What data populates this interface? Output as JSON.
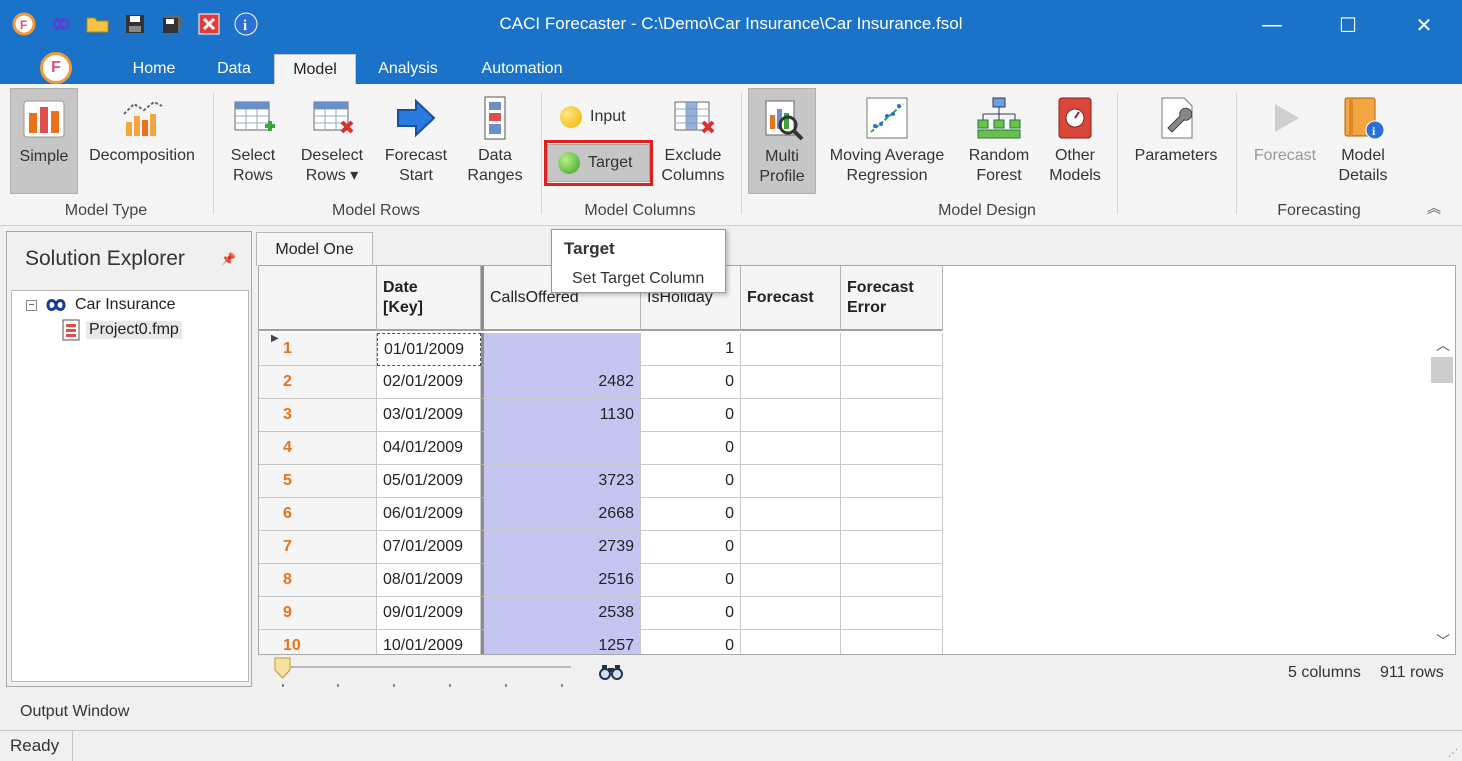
{
  "window": {
    "title": "CACI Forecaster - C:\\Demo\\Car Insurance\\Car Insurance.fsol",
    "minimize": "—",
    "maximize": "☐",
    "close": "✕"
  },
  "quick_access": [
    {
      "icon": "forecaster-logo-icon"
    },
    {
      "icon": "infinity-link-icon"
    },
    {
      "icon": "open-folder-icon"
    },
    {
      "icon": "save-icon"
    },
    {
      "icon": "save-all-icon"
    },
    {
      "icon": "close-red-icon"
    },
    {
      "icon": "info-icon"
    }
  ],
  "app_logo": "F",
  "tabs": [
    "Home",
    "Data",
    "Model",
    "Analysis",
    "Automation"
  ],
  "active_tab": "Model",
  "ribbon": {
    "model_type": {
      "label": "Model Type",
      "simple": "Simple",
      "decomposition": "Decomposition"
    },
    "model_rows": {
      "label": "Model Rows",
      "select_rows": [
        "Select",
        "Rows"
      ],
      "deselect_rows": [
        "Deselect",
        "Rows ▾"
      ],
      "forecast_start": [
        "Forecast",
        "Start"
      ],
      "data_ranges": [
        "Data",
        "Ranges"
      ]
    },
    "model_columns": {
      "label": "Model Columns",
      "input": "Input",
      "target": "Target",
      "exclude_columns": [
        "Exclude",
        "Columns"
      ]
    },
    "model_design": {
      "label": "Model Design",
      "multi_profile": [
        "Multi",
        "Profile"
      ],
      "moving_average": [
        "Moving Average",
        "Regression"
      ],
      "random_forest": [
        "Random",
        "Forest"
      ],
      "other_models": [
        "Other",
        "Models"
      ],
      "parameters": "Parameters"
    },
    "forecasting": {
      "label": "Forecasting",
      "forecast": "Forecast",
      "model_details": [
        "Model",
        "Details"
      ]
    }
  },
  "colors": {
    "title_bar": "#1a73c8",
    "target_highlight": "#e02020",
    "target_column_bg": "#c5c5f2",
    "row_number": "#e8731a"
  },
  "solution_explorer": {
    "title": "Solution Explorer",
    "tree": {
      "root": "Car Insurance",
      "child": "Project0.fmp"
    }
  },
  "document_tab": "Model One",
  "grid": {
    "columns": [
      {
        "label": [
          "Date",
          "[Key]"
        ],
        "bold": true
      },
      {
        "label": [
          "CallsOffered"
        ],
        "bold": false
      },
      {
        "label": [
          "IsHoliday"
        ],
        "bold": false
      },
      {
        "label": [
          "Forecast"
        ],
        "bold": true
      },
      {
        "label": [
          "Forecast",
          "Error"
        ],
        "bold": true
      }
    ],
    "rows": [
      {
        "n": "1",
        "date": "01/01/2009",
        "calls": "",
        "holiday": "1"
      },
      {
        "n": "2",
        "date": "02/01/2009",
        "calls": "2482",
        "holiday": "0"
      },
      {
        "n": "3",
        "date": "03/01/2009",
        "calls": "1130",
        "holiday": "0"
      },
      {
        "n": "4",
        "date": "04/01/2009",
        "calls": "",
        "holiday": "0"
      },
      {
        "n": "5",
        "date": "05/01/2009",
        "calls": "3723",
        "holiday": "0"
      },
      {
        "n": "6",
        "date": "06/01/2009",
        "calls": "2668",
        "holiday": "0"
      },
      {
        "n": "7",
        "date": "07/01/2009",
        "calls": "2739",
        "holiday": "0"
      },
      {
        "n": "8",
        "date": "08/01/2009",
        "calls": "2516",
        "holiday": "0"
      },
      {
        "n": "9",
        "date": "09/01/2009",
        "calls": "2538",
        "holiday": "0"
      },
      {
        "n": "10",
        "date": "10/01/2009",
        "calls": "1257",
        "holiday": "0"
      }
    ]
  },
  "grid_footer": {
    "columns_count": "5 columns",
    "rows_count": "911 rows"
  },
  "tooltip": {
    "title": "Target",
    "description": "Set Target Column"
  },
  "output_window": "Output Window",
  "status": "Ready"
}
